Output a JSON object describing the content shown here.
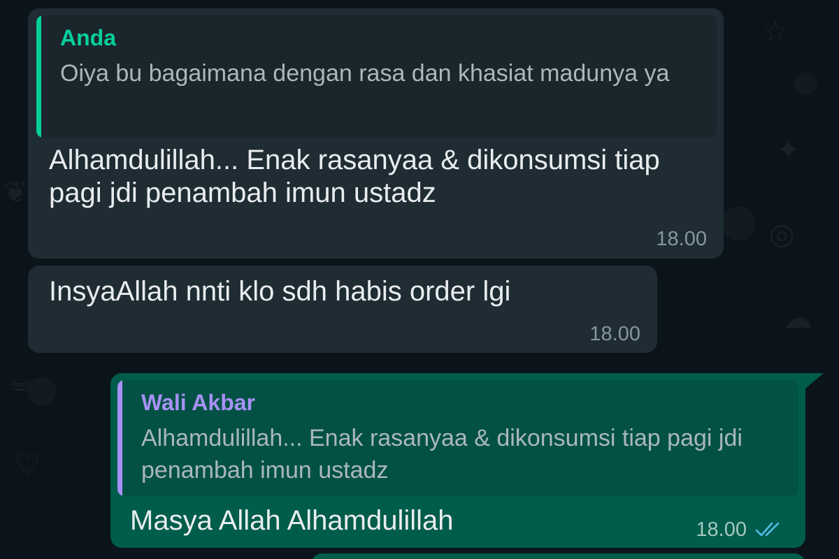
{
  "colors": {
    "background": "#0b141a",
    "incoming_bubble": "#1f2c34",
    "outgoing_bubble": "#005c4b",
    "quote_bar_you": "#06cf9c",
    "quote_bar_other": "#a791f4",
    "read_ticks": "#53bdeb"
  },
  "messages": [
    {
      "direction": "incoming",
      "quote": {
        "author": "Anda",
        "text": "Oiya bu bagaimana dengan rasa dan khasiat madunya ya"
      },
      "text": "Alhamdulillah... Enak rasanyaa & dikonsumsi tiap pagi jdi penambah imun ustadz",
      "time": "18.00"
    },
    {
      "direction": "incoming",
      "text": "InsyaAllah nnti klo sdh habis order lgi",
      "time": "18.00"
    },
    {
      "direction": "outgoing",
      "quote": {
        "author": "Wali Akbar",
        "text": "Alhamdulillah... Enak rasanyaa & dikonsumsi tiap pagi jdi penambah imun ustadz"
      },
      "text": "Masya Allah Alhamdulillah",
      "time": "18.00",
      "status_icon": "double-check-read-icon"
    }
  ]
}
